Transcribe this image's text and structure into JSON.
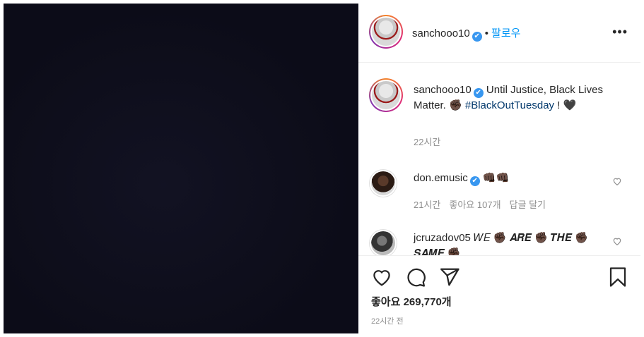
{
  "post": {
    "username": "sanchooo10",
    "follow_label": "팔로우",
    "separator": "•",
    "more_label": "•••"
  },
  "caption": {
    "username": "sanchooo10",
    "text_before": "Until Justice, Black Lives Matter. ✊🏿 ",
    "hashtag": "#BlackOutTuesday",
    "text_after": " ! 🖤",
    "time": "22시간"
  },
  "comments": [
    {
      "username": "don.emusic",
      "text": "👊🏿👊🏿",
      "time": "21시간",
      "likes": "좋아요 107개",
      "reply": "답글 달기"
    },
    {
      "username": "jcruzadov05",
      "text": "𝑊𝐸 ✊🏿 𝑨𝑹𝑬 ✊🏿 𝑻𝑯𝑬 ✊🏿 𝑺𝑨𝑴𝑬 ✊🏿"
    }
  ],
  "footer": {
    "likes": "좋아요 269,770개",
    "posted": "22시간 전"
  },
  "icons": {
    "like": "heart-outline-icon",
    "comment": "comment-bubble-icon",
    "share": "paper-plane-icon",
    "save": "bookmark-icon",
    "verified": "verified-badge-icon"
  },
  "colors": {
    "accent": "#0095f6",
    "verified": "#3897f0",
    "hashtag": "#00376b",
    "secondary_text": "#8e8e8e",
    "image_bg": "#0c0c18"
  }
}
